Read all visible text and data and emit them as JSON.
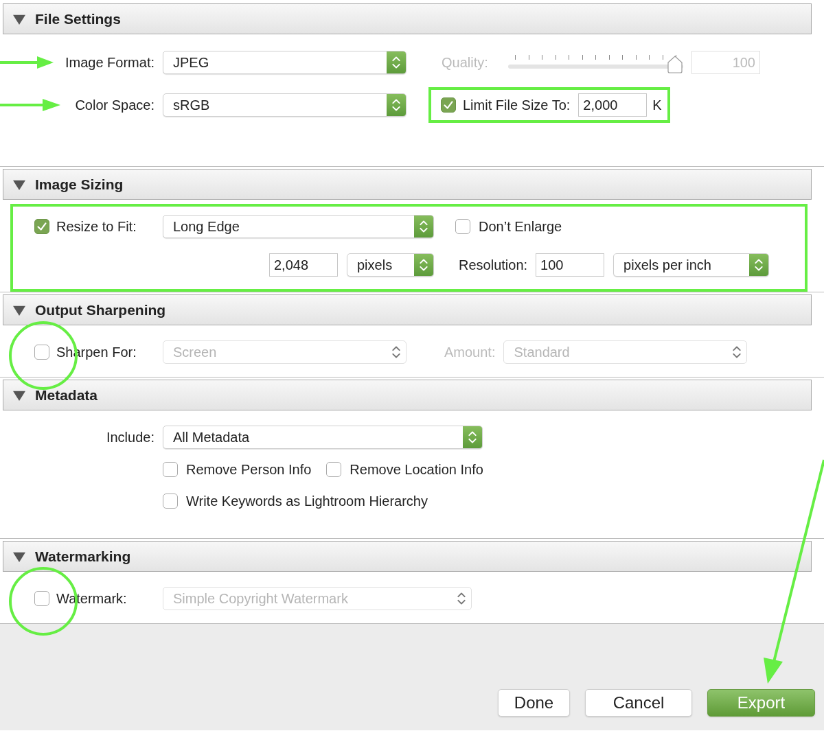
{
  "file_settings": {
    "title": "File Settings",
    "expanded": true,
    "image_format": {
      "label": "Image Format:",
      "value": "JPEG",
      "disabled": false
    },
    "color_space": {
      "label": "Color Space:",
      "value": "sRGB",
      "disabled": false
    },
    "quality": {
      "label": "Quality:",
      "disabled": true,
      "level": 1,
      "value": "100"
    },
    "limit_file_size": {
      "label": "Limit File Size To:",
      "checked": true,
      "value": "2,000",
      "unit": "K"
    }
  },
  "image_sizing": {
    "title": "Image Sizing",
    "expanded": true,
    "resize_to_fit": {
      "label": "Resize to Fit:",
      "checked": true,
      "value": "Long Edge",
      "disabled": false
    },
    "dont_enlarge": {
      "label": "Don’t Enlarge",
      "checked": false
    },
    "size": {
      "value": "2,048"
    },
    "size_unit": {
      "value": "pixels",
      "disabled": false
    },
    "resolution": {
      "label": "Resolution:",
      "value": "100"
    },
    "resolution_unit": {
      "value": "pixels per inch",
      "disabled": false
    }
  },
  "output_sharpening": {
    "title": "Output Sharpening",
    "expanded": true,
    "sharpen_for": {
      "label": "Sharpen For:",
      "checked": false,
      "value": "Screen",
      "disabled": true
    },
    "amount": {
      "label": "Amount:",
      "value": "Standard",
      "disabled": true
    }
  },
  "metadata": {
    "title": "Metadata",
    "expanded": true,
    "include": {
      "label": "Include:",
      "value": "All Metadata",
      "disabled": false
    },
    "options": [
      {
        "label": "Remove Person Info",
        "checked": false
      },
      {
        "label": "Remove Location Info",
        "checked": false
      },
      {
        "label": "Write Keywords as Lightroom Hierarchy",
        "checked": false
      }
    ]
  },
  "watermarking": {
    "title": "Watermarking",
    "expanded": true,
    "watermark": {
      "label": "Watermark:",
      "checked": false,
      "value": "Simple Copyright Watermark",
      "disabled": true
    }
  },
  "buttons": [
    {
      "label": "Done",
      "kind": "normal"
    },
    {
      "label": "Cancel",
      "kind": "normal"
    },
    {
      "label": "Export",
      "kind": "primary"
    }
  ]
}
